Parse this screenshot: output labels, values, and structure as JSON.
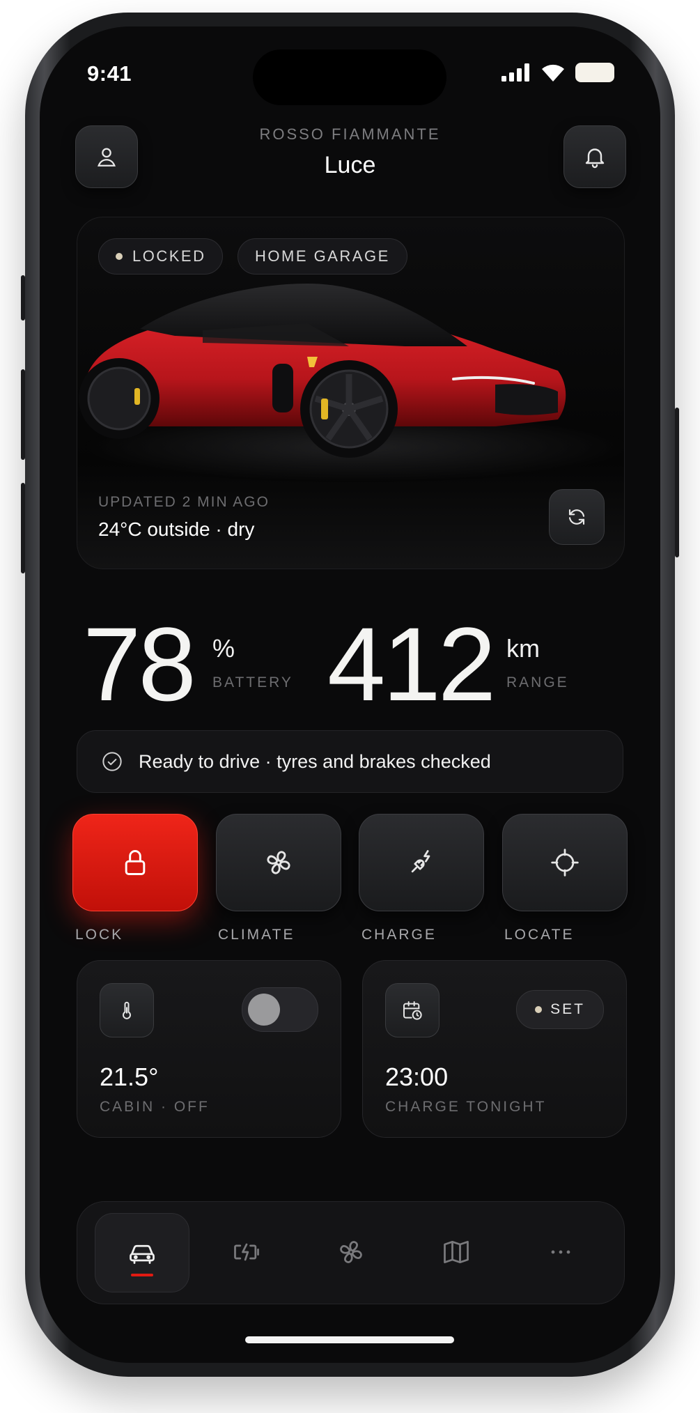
{
  "status": {
    "time": "9:41"
  },
  "header": {
    "subtitle": "ROSSO FIAMMANTE",
    "title": "Luce",
    "profile_icon": "user-icon",
    "notify_icon": "bell-icon"
  },
  "hero": {
    "chips": [
      "LOCKED",
      "HOME GARAGE"
    ],
    "updated": "UPDATED 2 MIN AGO",
    "weather": "24°C outside · dry",
    "car_color": "#d01c1f"
  },
  "stats": {
    "battery": {
      "value": "78",
      "unit": "%",
      "label": "BATTERY"
    },
    "range": {
      "value": "412",
      "unit": "km",
      "label": "RANGE"
    }
  },
  "status_bar": {
    "text": "Ready to drive · tyres and brakes checked"
  },
  "actions": [
    {
      "label": "LOCK",
      "icon": "lock-icon",
      "active": true
    },
    {
      "label": "CLIMATE",
      "icon": "fan-icon",
      "active": false
    },
    {
      "label": "CHARGE",
      "icon": "plug-icon",
      "active": false
    },
    {
      "label": "LOCATE",
      "icon": "crosshair-icon",
      "active": false
    }
  ],
  "tiles": {
    "climate": {
      "value": "21.5°",
      "label": "CABIN · OFF",
      "toggle_on": false
    },
    "charge": {
      "value": "23:00",
      "label": "CHARGE TONIGHT",
      "chip": "SET"
    }
  },
  "tabbar": {
    "items": [
      "car-icon",
      "battery-charging-icon",
      "fan-icon",
      "map-icon",
      "more-icon"
    ],
    "active": 0
  },
  "colors": {
    "accent": "#e11a12",
    "background": "#0a0a0b"
  }
}
